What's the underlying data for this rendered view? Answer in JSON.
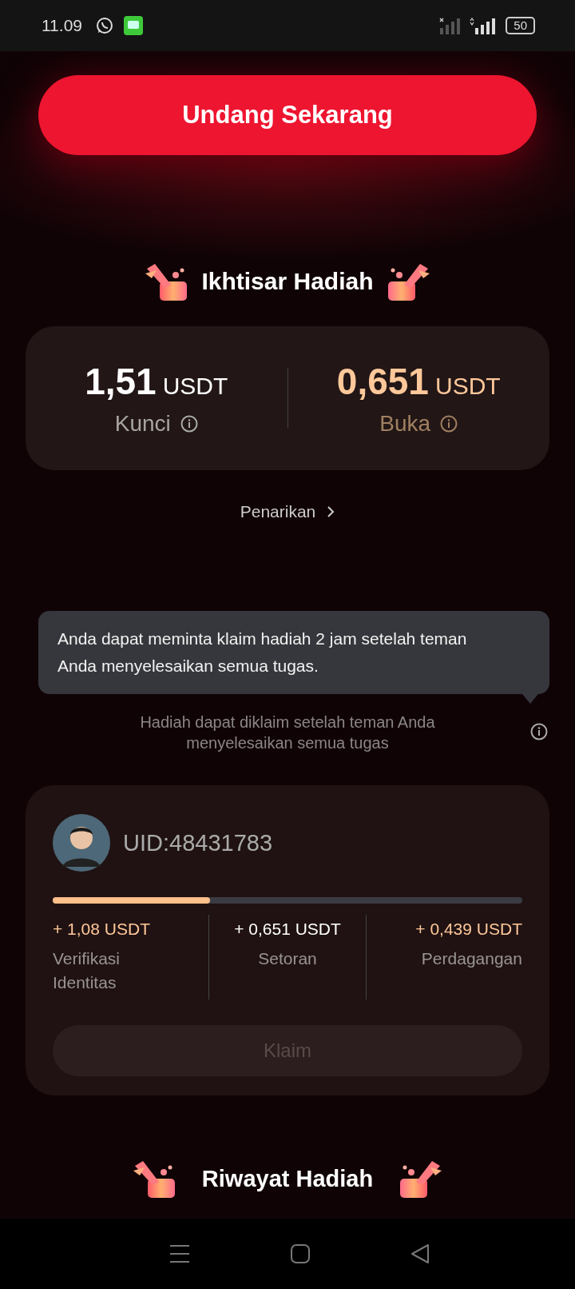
{
  "status_bar": {
    "time": "11.09",
    "battery": "50"
  },
  "invite_button": {
    "label": "Undang Sekarang"
  },
  "overview": {
    "title": "Ikhtisar Hadiah",
    "balances": [
      {
        "amount": "1,51",
        "unit": "USDT",
        "label": "Kunci",
        "color": "#ffffff"
      },
      {
        "amount": "0,651",
        "unit": "USDT",
        "label": "Buka",
        "color": "#ffc89a"
      }
    ],
    "withdraw_link": "Penarikan"
  },
  "tooltip": "Anda dapat meminta klaim hadiah 2 jam setelah teman Anda menyelesaikan semua tugas.",
  "hint": "Hadiah dapat diklaim setelah teman Anda menyelesaikan semua tugas",
  "friend": {
    "uid": "UID:48431783",
    "level": 0.335,
    "tasks": [
      {
        "amount": "+ 1,08 USDT",
        "label": "Verifikasi Identitas",
        "color": "#ffc89a"
      },
      {
        "amount": "+ 0,651 USDT",
        "label": "Setoran",
        "color": "#ffffff"
      },
      {
        "amount": "+ 0,439 USDT",
        "label": "Perdagangan",
        "color": "#ffc89a"
      }
    ],
    "claim": {
      "label": "Klaim",
      "disabled": true
    }
  },
  "history": {
    "title": "Riwayat Hadiah"
  }
}
